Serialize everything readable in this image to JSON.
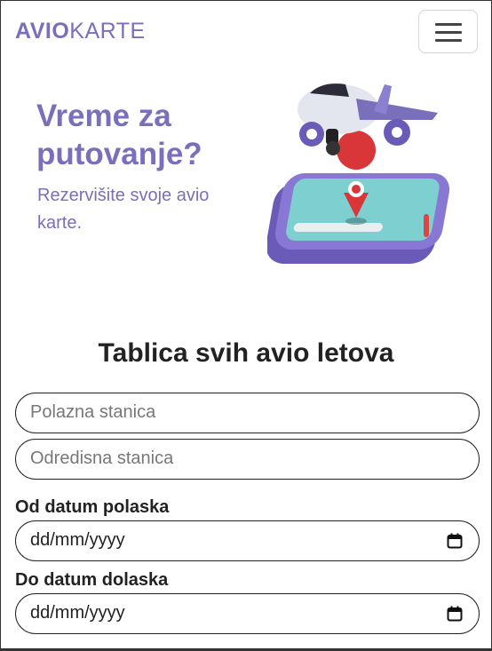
{
  "brand": {
    "part1": "AVIO",
    "part2": "KARTE"
  },
  "hero": {
    "title": "Vreme za putovanje?",
    "subtitle": "Rezervišite svoje avio karte."
  },
  "section": {
    "title": "Tablica svih avio letova"
  },
  "form": {
    "departure_placeholder": "Polazna stanica",
    "destination_placeholder": "Odredisna stanica",
    "from_date_label": "Od datum polaska",
    "from_date_value": "dd/mm/yyyy",
    "to_date_label": "Do datum dolaska",
    "to_date_value": "dd/mm/yyyy"
  },
  "colors": {
    "brand": "#7a6fba",
    "border": "#222222",
    "text": "#222222"
  },
  "icons": [
    "hamburger-menu-icon",
    "calendar-icon"
  ]
}
